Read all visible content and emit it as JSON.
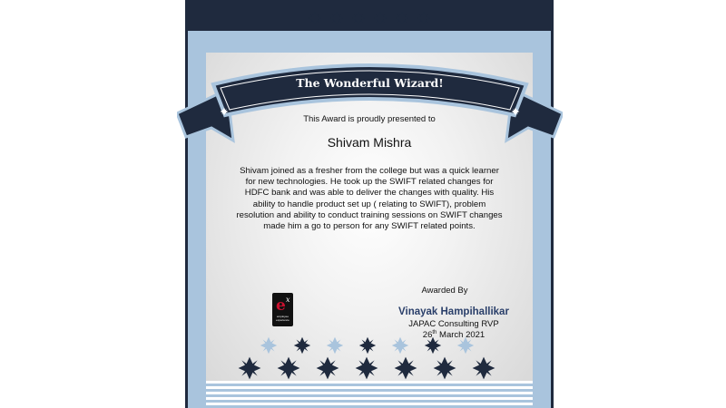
{
  "certificate": {
    "banner_title": "The Wonderful Wizard!",
    "presented_line": "This Award is proudly  presented to",
    "recipient_name": "Shivam Mishra",
    "citation": "Shivam joined as a fresher from the college but was a quick learner for new technologies. He took up the SWIFT related changes for HDFC bank and was able to deliver the changes with quality. His ability to handle product set up ( relating to SWIFT), problem resolution and ability to conduct training sessions on SWIFT changes made him a go to person for any SWIFT related points.",
    "awarded_by_label": "Awarded By",
    "signer_name": "Vinayak Hampihallikar",
    "signer_title": "JAPAC Consulting RVP",
    "date_day": "26",
    "date_suffix": "th",
    "date_rest": " March 2021"
  },
  "logo": {
    "letter": "e",
    "superscript": "x",
    "line1": "employee",
    "line2": "experience"
  },
  "colors": {
    "navy": "#1f2a3e",
    "light_blue": "#a9c4dd",
    "logo_red": "#c8102e"
  }
}
